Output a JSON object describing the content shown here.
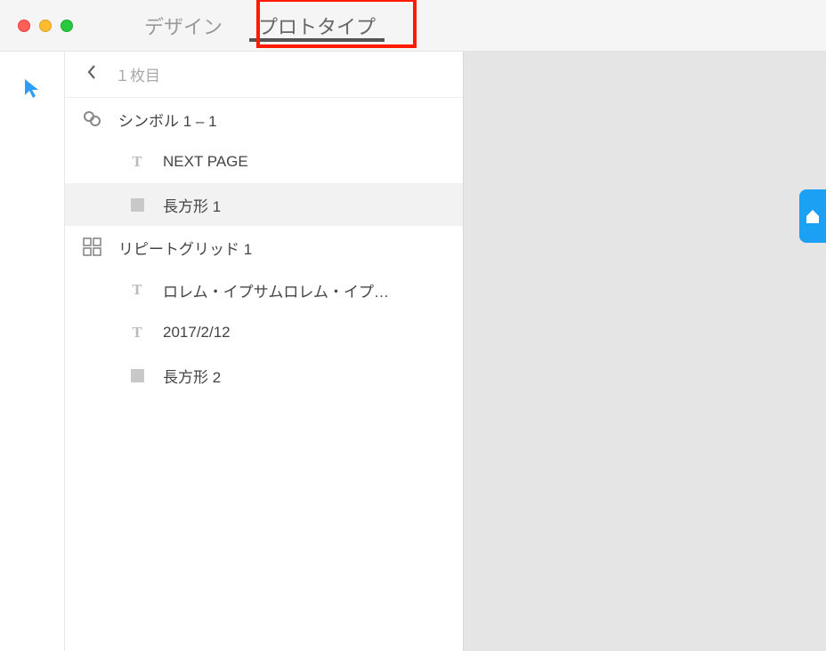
{
  "tabs": {
    "design": "デザイン",
    "prototype": "プロトタイプ"
  },
  "breadcrumb": {
    "page_label": "１枚目"
  },
  "layers": {
    "symbol1": "シンボル 1 – 1",
    "next_page": "NEXT PAGE",
    "rect1": "長方形 1",
    "repeat_grid": "リピートグリッド 1",
    "lorem": "ロレム・イプサムロレム・イプ…",
    "date": "2017/2/12",
    "rect2": "長方形 2"
  }
}
